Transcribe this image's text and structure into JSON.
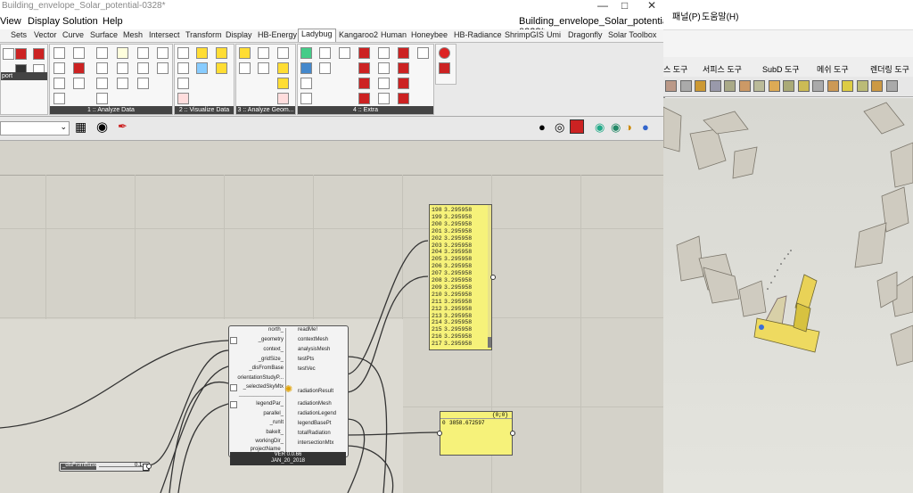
{
  "gh": {
    "window_title": "Building_envelope_Solar_potential-0328*",
    "menu": [
      "View",
      "Display",
      "Solution",
      "Help"
    ],
    "doc_name": "Building_envelope_Solar_potential-0328*",
    "tabs": [
      "Sets",
      "Vector",
      "Curve",
      "Surface",
      "Mesh",
      "Intersect",
      "Transform",
      "Display",
      "HB-Energy",
      "Ladybug",
      "Kangaroo2",
      "Human",
      "Honeybee",
      "HB-Radiance",
      "ShrimpGIS",
      "Umi",
      "Dragonfly",
      "Solar Toolbox"
    ],
    "active_tab": "Ladybug",
    "ribbon_groups": [
      "1 :: Analyze Data",
      "2 :: Visualize Data",
      "3 :: Analyze Geom...",
      "4 :: Extra"
    ],
    "left_fragment": "port",
    "panel_list": {
      "rows": [
        {
          "i": "198",
          "v": "3.295958"
        },
        {
          "i": "199",
          "v": "3.295958"
        },
        {
          "i": "200",
          "v": "3.295958"
        },
        {
          "i": "201",
          "v": "3.295958"
        },
        {
          "i": "202",
          "v": "3.295958"
        },
        {
          "i": "203",
          "v": "3.295958"
        },
        {
          "i": "204",
          "v": "3.295958"
        },
        {
          "i": "205",
          "v": "3.295958"
        },
        {
          "i": "206",
          "v": "3.295958"
        },
        {
          "i": "207",
          "v": "3.295958"
        },
        {
          "i": "208",
          "v": "3.295958"
        },
        {
          "i": "209",
          "v": "3.295958"
        },
        {
          "i": "210",
          "v": "3.295958"
        },
        {
          "i": "211",
          "v": "3.295958"
        },
        {
          "i": "212",
          "v": "3.295958"
        },
        {
          "i": "213",
          "v": "3.295958"
        },
        {
          "i": "214",
          "v": "3.295958"
        },
        {
          "i": "215",
          "v": "3.295958"
        },
        {
          "i": "216",
          "v": "3.295958"
        },
        {
          "i": "217",
          "v": "3.295958"
        }
      ]
    },
    "panel_total": {
      "header": "{0;0}",
      "row_index": "0",
      "row_value": "3858.672597"
    },
    "component": {
      "inputs": [
        "north_",
        "_geometry",
        "context_",
        "_gridSize_",
        "_disFromBase",
        "orientationStudyP...",
        "_selectedSkyMtx",
        "legendPar_",
        "parallel_",
        "_runIt",
        "bakeIt_",
        "workingDir_",
        "projectName_"
      ],
      "outputs": [
        "readMe!",
        "contextMesh",
        "analysisMesh",
        "testPts",
        "testVec",
        "radiationResult",
        "radiationMesh",
        "radiationLegend",
        "legendBasePt",
        "totalRadiation",
        "intersectionMtx"
      ],
      "divider": "_______________",
      "version": "VER 0.0.66",
      "date": "JAN_20_2018"
    },
    "slider": {
      "label": "_disFromBase",
      "value": "0.1"
    }
  },
  "rhino": {
    "menu": [
      "패널(P)",
      "도움말(H)"
    ],
    "tabs": [
      "스 도구",
      "서피스 도구",
      "SubD 도구",
      "메쉬 도구",
      "렌더링 도구"
    ]
  },
  "colors": {
    "canvas": "#d4d2c9",
    "panel": "#f6f27a",
    "active_tab": "#ffffff",
    "highlight_building": "#f0e060"
  },
  "icons": [
    "close-icon",
    "maximize-icon",
    "minimize-icon",
    "eye-icon",
    "sun-icon"
  ]
}
